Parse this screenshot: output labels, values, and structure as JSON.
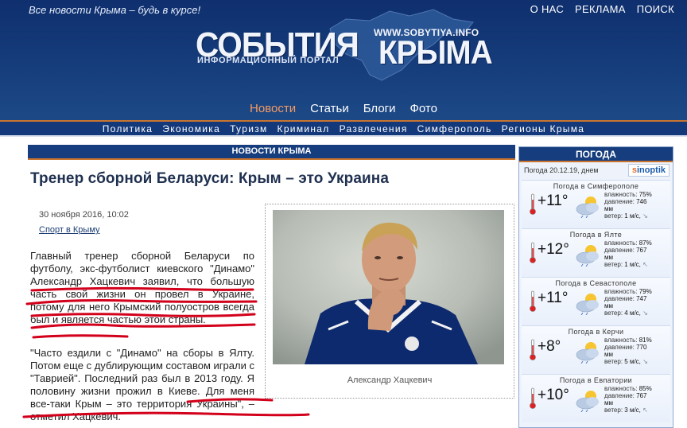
{
  "header": {
    "slogan": "Все новости Крыма – будь в курсе!",
    "top_links": [
      "О НАС",
      "РЕКЛАМА",
      "ПОИСК"
    ],
    "logo_word1": "СОБЫТИЯ",
    "logo_word2": "КРЫМА",
    "logo_url": "WWW.SOBYTIYA.INFO",
    "logo_subtitle": "ИНФОРМАЦИОННЫЙ ПОРТАЛ",
    "main_nav": [
      "Новости",
      "Статьи",
      "Блоги",
      "Фото"
    ],
    "main_nav_active": "Новости",
    "sub_nav": [
      "Политика",
      "Экономика",
      "Туризм",
      "Криминал",
      "Развлечения",
      "Симферополь",
      "Регионы Крыма"
    ]
  },
  "main": {
    "section_title": "НОВОСТИ КРЫМА",
    "article": {
      "title": "Тренер сборной Беларуси: Крым – это Украина",
      "date": "30 ноября 2016, 10:02",
      "category": "Спорт в Крыму",
      "paragraph1": "Главный тренер сборной Беларуси по футболу, экс-футболист киевского \"Динамо\" Александр Хацкевич заявил, что большую часть свой жизни он провел в Украине, потому для него Крымский полуостров всегда был и является частью этой страны.",
      "paragraph2": "\"Часто ездили с \"Динамо\" на сборы в Ялту. Потом еще с дублирующим составом играли с \"Таврией\". Последний раз был в 2013 году. Я половину жизни прожил в Киеве. Для меня все-таки Крым – это территория Украины\", – отметил Хацкевич.",
      "photo_caption": "Александр Хацкевич"
    }
  },
  "weather": {
    "title": "ПОГОДА",
    "meta": "Погода 20.12.19, днем",
    "provider": "sinoptik",
    "cities": [
      {
        "city": "Погода в Симферополе",
        "temp": "+11°",
        "humidity_label": "влажность:",
        "humidity": "75%",
        "pressure_label": "давление:",
        "pressure": "746",
        "pressure_unit": "мм",
        "wind_label": "ветер:",
        "wind": "1 м/с,",
        "wind_dir": "↘"
      },
      {
        "city": "Погода в Ялте",
        "temp": "+12°",
        "humidity_label": "влажность:",
        "humidity": "87%",
        "pressure_label": "давление:",
        "pressure": "767",
        "pressure_unit": "мм",
        "wind_label": "ветер:",
        "wind": "1 м/с,",
        "wind_dir": "↖"
      },
      {
        "city": "Погода в Севастополе",
        "temp": "+11°",
        "humidity_label": "влажность:",
        "humidity": "79%",
        "pressure_label": "давление:",
        "pressure": "747",
        "pressure_unit": "мм",
        "wind_label": "ветер:",
        "wind": "4 м/с,",
        "wind_dir": "↘"
      },
      {
        "city": "Погода в Керчи",
        "temp": "+8°",
        "humidity_label": "влажность:",
        "humidity": "81%",
        "pressure_label": "давление:",
        "pressure": "770",
        "pressure_unit": "мм",
        "wind_label": "ветер:",
        "wind": "5 м/с,",
        "wind_dir": "↘"
      },
      {
        "city": "Погода в Евпатории",
        "temp": "+10°",
        "humidity_label": "влажность:",
        "humidity": "85%",
        "pressure_label": "давление:",
        "pressure": "767",
        "pressure_unit": "мм",
        "wind_label": "ветер:",
        "wind": "3 м/с,",
        "wind_dir": "↖"
      }
    ]
  },
  "colors": {
    "header_blue": "#163d7d",
    "accent_orange": "#c9752f",
    "active_nav": "#f39a62",
    "annotation_red": "#d3001b"
  }
}
